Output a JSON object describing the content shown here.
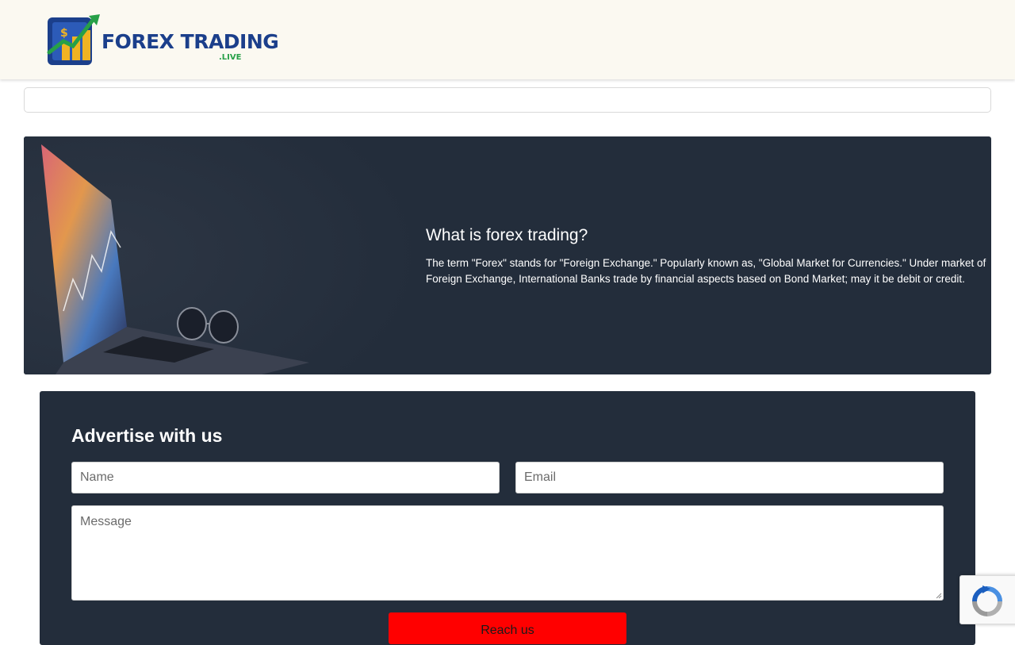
{
  "header": {
    "logo_text": "FOREX TRADING",
    "logo_subtext": ".LIVE"
  },
  "hero": {
    "title": "What is forex trading?",
    "text": "The term \"Forex\" stands for \"Foreign Exchange.\" Popularly known as, \"Global Market for Currencies.\" Under market of Foreign Exchange, International Banks trade by financial aspects based on Bond Market; may it be debit or credit."
  },
  "advertise": {
    "title": "Advertise with us",
    "name_placeholder": "Name",
    "email_placeholder": "Email",
    "message_placeholder": "Message",
    "submit_label": "Reach us"
  },
  "colors": {
    "header_bg": "#fbf9f1",
    "panel_bg": "#232d3b",
    "logo_blue": "#1b3f8b",
    "logo_green": "#27a048",
    "button_red": "#ff0000"
  },
  "icons": {
    "recaptcha": "recaptcha-icon"
  }
}
